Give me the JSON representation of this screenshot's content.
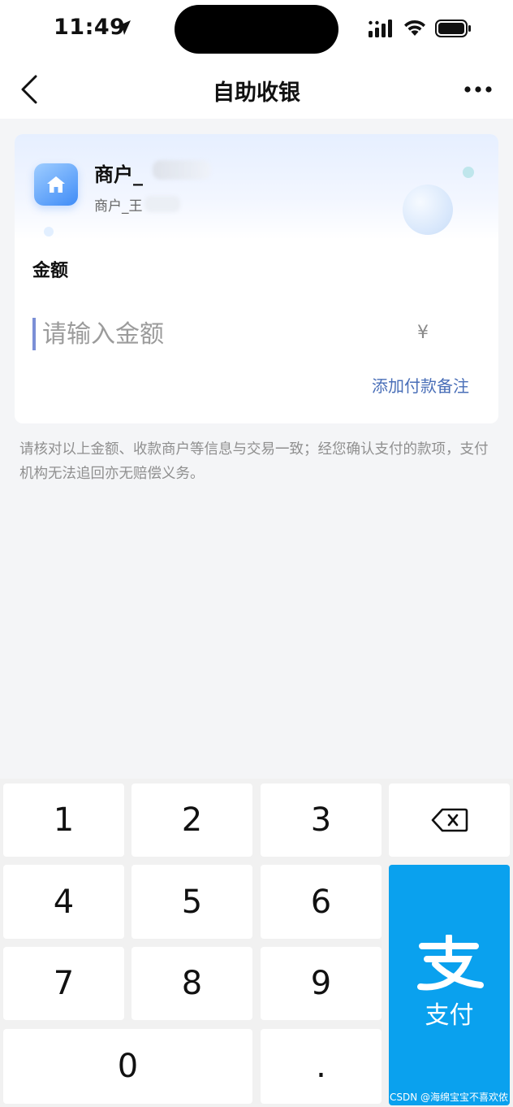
{
  "status_bar": {
    "time": "11:49",
    "location_icon": "location-arrow-icon",
    "signal_icon": "cellular-signal-icon",
    "wifi_icon": "wifi-icon",
    "battery_icon": "battery-icon"
  },
  "nav": {
    "title": "自助收银",
    "back_icon": "chevron-left-icon",
    "more_icon": "more-dots-icon"
  },
  "merchant": {
    "icon": "home-icon",
    "name": "商户_",
    "sub": "商户_王"
  },
  "amount": {
    "label": "金额",
    "placeholder": "请输入金额",
    "value": "",
    "currency": "¥",
    "add_note": "添加付款备注"
  },
  "notice": "请核对以上金额、收款商户等信息与交易一致；经您确认支付的款项，支付机构无法追回亦无赔偿义务。",
  "keypad": {
    "k1": "1",
    "k2": "2",
    "k3": "3",
    "k4": "4",
    "k5": "5",
    "k6": "6",
    "k7": "7",
    "k8": "8",
    "k9": "9",
    "k0": "0",
    "kdot": ".",
    "backspace_icon": "backspace-icon",
    "pay_icon": "alipay-logo-icon",
    "pay_label": "支付"
  },
  "watermark": "CSDN @海绵宝宝不喜欢侬",
  "colors": {
    "accent_blue": "#0aa1ee",
    "link_blue": "#4a6fb8",
    "caret": "#7b8fd6",
    "background": "#f4f5f7"
  }
}
